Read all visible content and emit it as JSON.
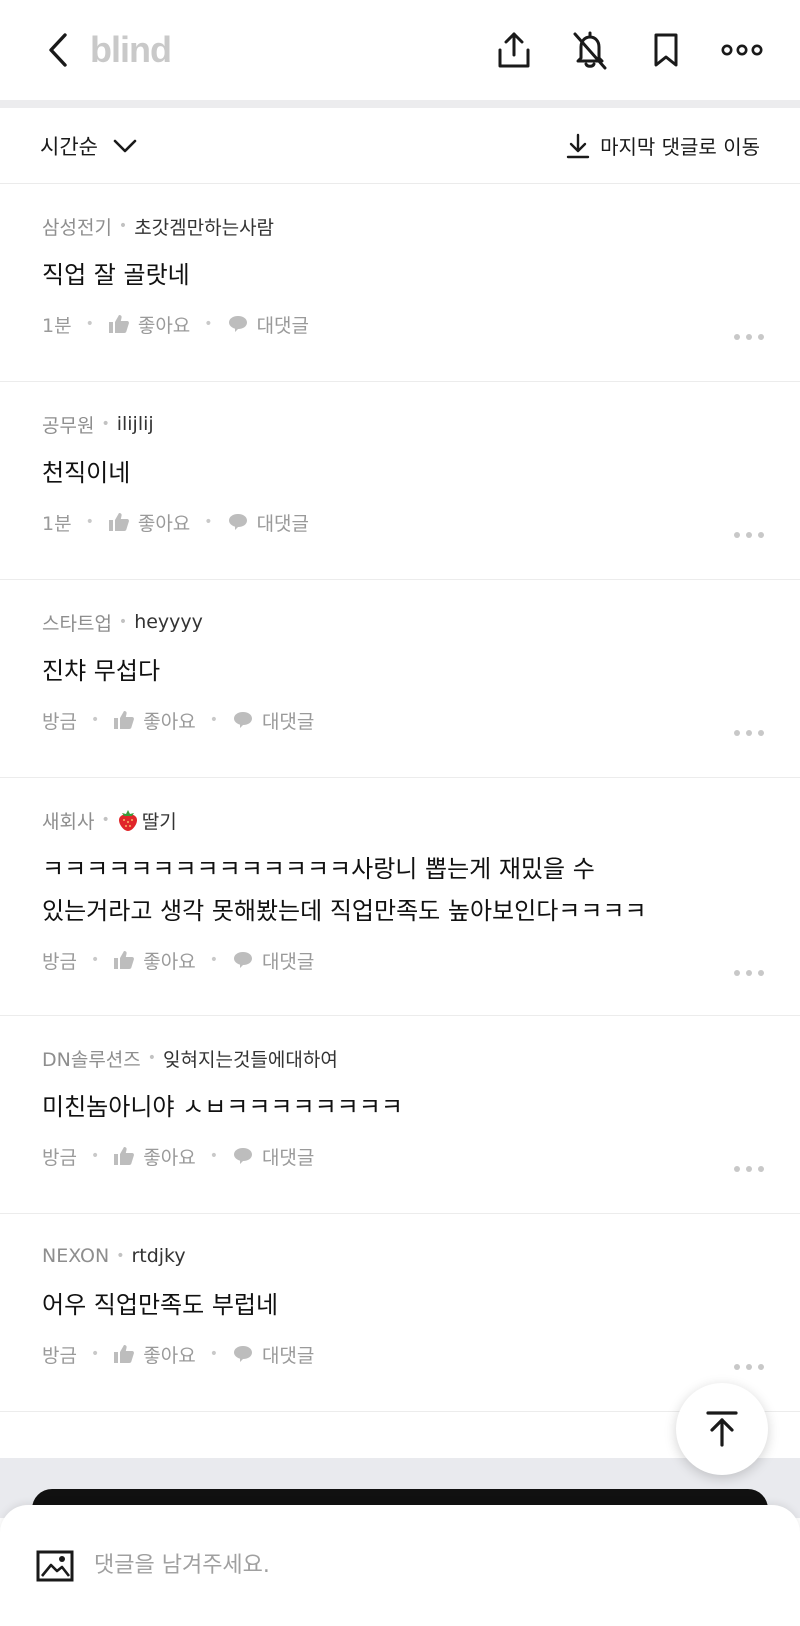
{
  "header": {
    "logo": "blind"
  },
  "sort": {
    "selected": "시간순",
    "jump_label": "마지막 댓글로 이동"
  },
  "labels": {
    "like": "좋아요",
    "reply": "대댓글"
  },
  "comments": [
    {
      "company": "삼성전기",
      "nick": "초갓겜만하는사람",
      "emoji": "",
      "text": "직업 잘 골랏네",
      "time": "1분"
    },
    {
      "company": "공무원",
      "nick": "ilijlij",
      "emoji": "",
      "text": "천직이네",
      "time": "1분"
    },
    {
      "company": "스타트업",
      "nick": "heyyyy",
      "emoji": "",
      "text": "진챠 무섭다",
      "time": "방금"
    },
    {
      "company": "새회사",
      "nick": "딸기",
      "emoji": "strawberry-icon",
      "text": "ㅋㅋㅋㅋㅋㅋㅋㅋㅋㅋㅋㅋㅋㅋ사랑니 뽑는게 재밌을 수\n있는거라고 생각 못해봤는데 직업만족도 높아보인다ㅋㅋㅋㅋ",
      "time": "방금"
    },
    {
      "company": "DN솔루션즈",
      "nick": "잊혀지는것들에대하여",
      "emoji": "",
      "text": "미친놈아니야 ㅅㅂㅋㅋㅋㅋㅋㅋㅋㅋ",
      "time": "방금"
    },
    {
      "company": "NEXON",
      "nick": "rtdjky",
      "emoji": "",
      "text": "어우 직업만족도 부럽네",
      "time": "방금"
    }
  ],
  "input": {
    "placeholder": "댓글을 남겨주세요.",
    "value": ""
  }
}
